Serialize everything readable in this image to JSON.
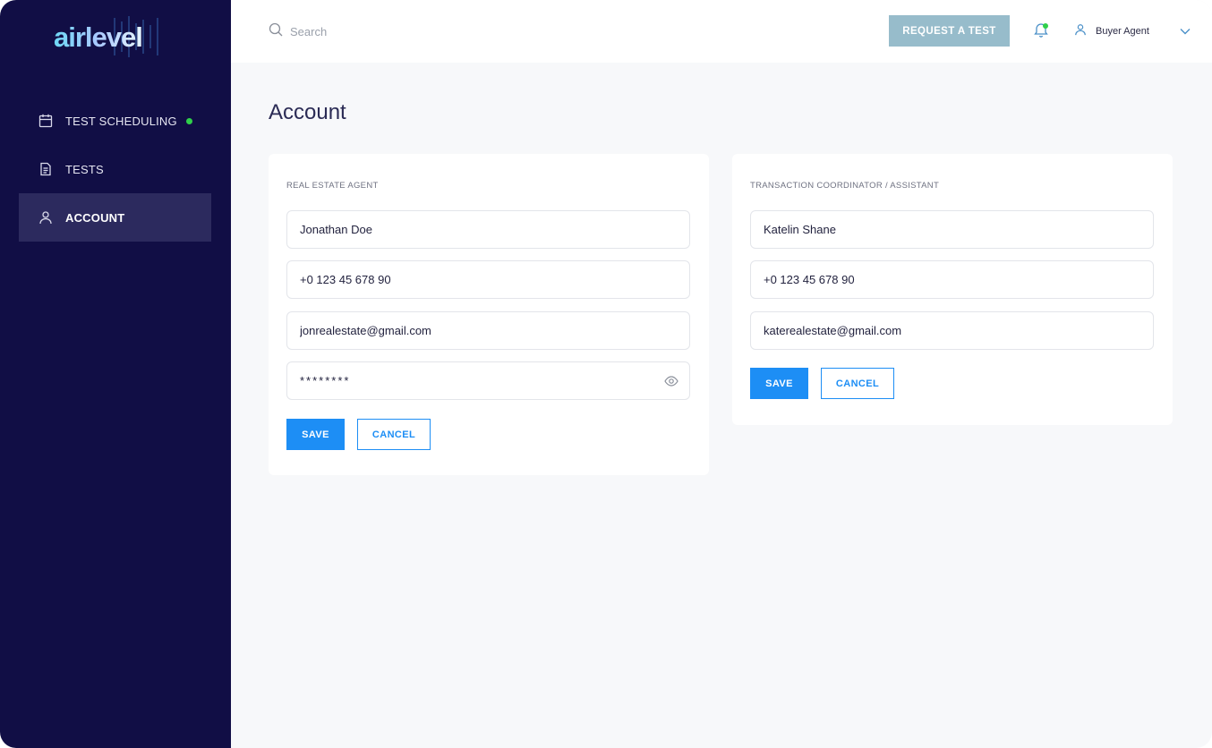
{
  "brand": {
    "logo_text": "airlevel",
    "sidebar_bg": "#110e45",
    "accent": "#1d8ef5",
    "status_dot": "#2fd04a"
  },
  "sidebar": {
    "items": [
      {
        "label": "TEST SCHEDULING",
        "icon": "calendar-icon",
        "active": false,
        "has_dot": true
      },
      {
        "label": "TESTS",
        "icon": "document-icon",
        "active": false
      },
      {
        "label": "ACCOUNT",
        "icon": "user-icon",
        "active": true
      }
    ]
  },
  "topbar": {
    "search_placeholder": "Search",
    "request_button": "REQUEST A TEST",
    "user_name": "Buyer Agent",
    "icons": [
      "search-icon",
      "bell-icon",
      "user-icon",
      "chevron-down-icon"
    ]
  },
  "main": {
    "title": "Account",
    "agent_card": {
      "label": "REAL ESTATE AGENT",
      "name": "Jonathan Doe",
      "phone": "+0 123 45 678 90",
      "email": "jonrealestate@gmail.com",
      "password": "********",
      "save_label": "SAVE",
      "cancel_label": "CANCEL"
    },
    "coordinator_card": {
      "label": "TRANSACTION COORDINATOR / ASSISTANT",
      "name": "Katelin Shane",
      "phone": "+0 123 45 678 90",
      "email": "katerealestate@gmail.com",
      "save_label": "SAVE",
      "cancel_label": "CANCEL"
    }
  }
}
